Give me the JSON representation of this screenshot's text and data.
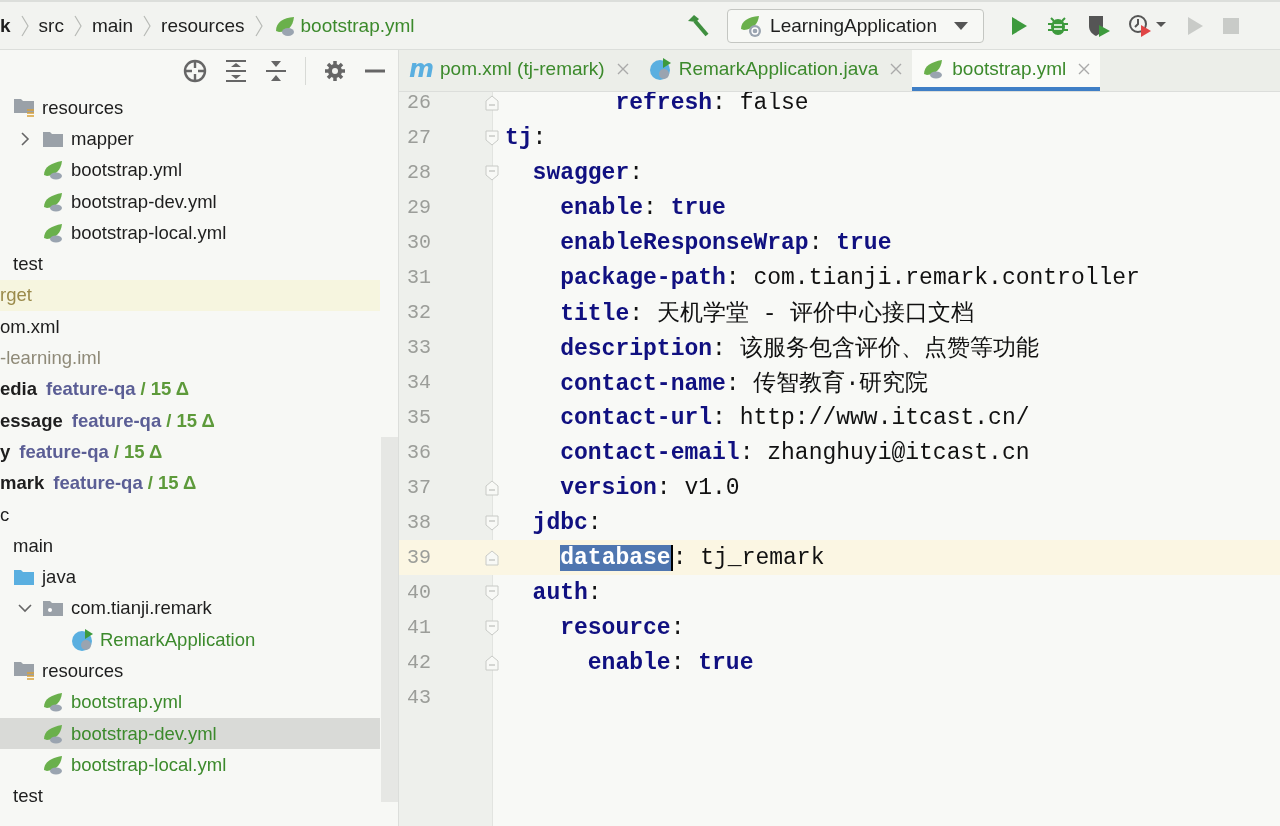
{
  "breadcrumb": [
    {
      "label": "k",
      "kind": "project"
    },
    {
      "label": "src",
      "kind": "folder"
    },
    {
      "label": "main",
      "kind": "folder"
    },
    {
      "label": "resources",
      "kind": "folder"
    },
    {
      "label": "bootstrap.yml",
      "kind": "file"
    }
  ],
  "run_toolbar": {
    "configuration": "LearningApplication"
  },
  "project_tree": [
    {
      "children": [
        {
          "children": [
            {
              "children": [
                {
                  "label": "resources",
                  "kind": "resources",
                  "selected": false,
                  "children": [
                    {
                      "label": "mapper",
                      "kind": "folder",
                      "expanded": false,
                      "selected": false
                    },
                    {
                      "label": "bootstrap.yml",
                      "kind": "spring",
                      "selected": false
                    },
                    {
                      "label": "bootstrap-dev.yml",
                      "kind": "spring",
                      "selected": false
                    },
                    {
                      "label": "bootstrap-local.yml",
                      "kind": "spring",
                      "selected": false
                    }
                  ]
                }
              ]
            },
            {
              "label": "test",
              "selected": false
            }
          ]
        },
        {
          "label": "rget",
          "kind": "excluded",
          "color": "#9a8a4a",
          "selected": false
        },
        {
          "label": "om.xml",
          "selected": false
        },
        {
          "label": "-learning.iml",
          "color": "#8f8a78",
          "selected": false
        }
      ]
    },
    {
      "label": "edia",
      "kind": "module",
      "branch": "feature-qa",
      "changes": "/ 15 Δ",
      "selected": false
    },
    {
      "label": "essage",
      "kind": "module",
      "branch": "feature-qa",
      "changes": "/ 15 Δ",
      "selected": false
    },
    {
      "label": "y",
      "kind": "module",
      "branch": "feature-qa",
      "changes": "/ 15 Δ",
      "selected": false
    },
    {
      "label": "mark",
      "kind": "module",
      "branch": "feature-qa",
      "changes": "/ 15 Δ",
      "selected": false,
      "children": [
        {
          "label": "c",
          "selected": false,
          "children": [
            {
              "label": "main",
              "selected": false,
              "children": [
                {
                  "label": "java",
                  "kind": "java-source",
                  "selected": false,
                  "children": [
                    {
                      "label": "com.tianji.remark",
                      "kind": "package",
                      "expanded": true,
                      "selected": false,
                      "children": [
                        {
                          "label": "RemarkApplication",
                          "kind": "spring-class",
                          "color": "#3c8a2c",
                          "selected": false
                        }
                      ]
                    }
                  ]
                },
                {
                  "label": "resources",
                  "kind": "resources",
                  "selected": false,
                  "children": [
                    {
                      "label": "bootstrap.yml",
                      "kind": "spring",
                      "color": "#3c8a2c",
                      "selected": false
                    },
                    {
                      "label": "bootstrap-dev.yml",
                      "kind": "spring",
                      "color": "#3c8a2c",
                      "selected": true
                    },
                    {
                      "label": "bootstrap-local.yml",
                      "kind": "spring",
                      "color": "#3c8a2c",
                      "selected": false
                    }
                  ]
                }
              ]
            },
            {
              "label": "test",
              "selected": false
            }
          ]
        }
      ]
    }
  ],
  "editor_tabs": [
    {
      "label": "pom.xml (tj-remark)",
      "kind": "maven",
      "glyph": "m",
      "selected": false
    },
    {
      "label": "RemarkApplication.java",
      "kind": "spring-class",
      "selected": false
    },
    {
      "label": "bootstrap.yml",
      "kind": "spring",
      "selected": true
    }
  ],
  "code_lines": [
    {
      "number": "26",
      "kind": "fold-end",
      "current": false,
      "parts": [
        {
          "text": "        refresh",
          "kind": "key"
        },
        {
          "text": ": false",
          "kind": "plain"
        }
      ]
    },
    {
      "number": "27",
      "kind": "fold-start",
      "current": false,
      "parts": [
        {
          "text": "tj",
          "kind": "key"
        },
        {
          "text": ":",
          "kind": "plain"
        }
      ]
    },
    {
      "number": "28",
      "kind": "fold-start",
      "current": false,
      "parts": [
        {
          "text": "  swagger",
          "kind": "key"
        },
        {
          "text": ":",
          "kind": "plain"
        }
      ]
    },
    {
      "number": "29",
      "current": false,
      "parts": [
        {
          "text": "    enable",
          "kind": "key"
        },
        {
          "text": ": ",
          "kind": "plain"
        },
        {
          "text": "true",
          "kind": "keyword"
        }
      ]
    },
    {
      "number": "30",
      "current": false,
      "parts": [
        {
          "text": "    enableResponseWrap",
          "kind": "key"
        },
        {
          "text": ": ",
          "kind": "plain"
        },
        {
          "text": "true",
          "kind": "keyword"
        }
      ]
    },
    {
      "number": "31",
      "current": false,
      "parts": [
        {
          "text": "    package-path",
          "kind": "key"
        },
        {
          "text": ": com.tianji.remark.controller",
          "kind": "plain"
        }
      ]
    },
    {
      "number": "32",
      "current": false,
      "parts": [
        {
          "text": "    title",
          "kind": "key"
        },
        {
          "text": ": 天机学堂 - 评价中心接口文档",
          "kind": "plain"
        }
      ]
    },
    {
      "number": "33",
      "current": false,
      "parts": [
        {
          "text": "    description",
          "kind": "key"
        },
        {
          "text": ": 该服务包含评价、点赞等功能",
          "kind": "plain"
        }
      ]
    },
    {
      "number": "34",
      "current": false,
      "parts": [
        {
          "text": "    contact-name",
          "kind": "key"
        },
        {
          "text": ": 传智教育·研究院",
          "kind": "plain"
        }
      ]
    },
    {
      "number": "35",
      "current": false,
      "parts": [
        {
          "text": "    contact-url",
          "kind": "key"
        },
        {
          "text": ": http://www.itcast.cn/",
          "kind": "plain"
        }
      ]
    },
    {
      "number": "36",
      "current": false,
      "parts": [
        {
          "text": "    contact-email",
          "kind": "key"
        },
        {
          "text": ": zhanghuyi@itcast.cn",
          "kind": "plain"
        }
      ]
    },
    {
      "number": "37",
      "kind": "fold-end",
      "current": false,
      "parts": [
        {
          "text": "    version",
          "kind": "key"
        },
        {
          "text": ": v1.0",
          "kind": "plain"
        }
      ]
    },
    {
      "number": "38",
      "kind": "fold-start",
      "current": false,
      "parts": [
        {
          "text": "  jdbc",
          "kind": "key"
        },
        {
          "text": ":",
          "kind": "plain"
        }
      ]
    },
    {
      "number": "39",
      "kind": "fold-end",
      "current": true,
      "parts": [
        {
          "text": "    database",
          "kind": "selection"
        },
        {
          "text": ": tj_remark",
          "kind": "plain"
        }
      ]
    },
    {
      "number": "40",
      "kind": "fold-start",
      "current": false,
      "parts": [
        {
          "text": "  auth",
          "kind": "key"
        },
        {
          "text": ":",
          "kind": "plain"
        }
      ]
    },
    {
      "number": "41",
      "kind": "fold-start",
      "current": false,
      "parts": [
        {
          "text": "    resource",
          "kind": "key"
        },
        {
          "text": ":",
          "kind": "plain"
        }
      ]
    },
    {
      "number": "42",
      "kind": "fold-end",
      "current": false,
      "parts": [
        {
          "text": "      enable",
          "kind": "key"
        },
        {
          "text": ": ",
          "kind": "plain"
        },
        {
          "text": "true",
          "kind": "keyword"
        }
      ]
    },
    {
      "number": "43",
      "current": false
    }
  ]
}
